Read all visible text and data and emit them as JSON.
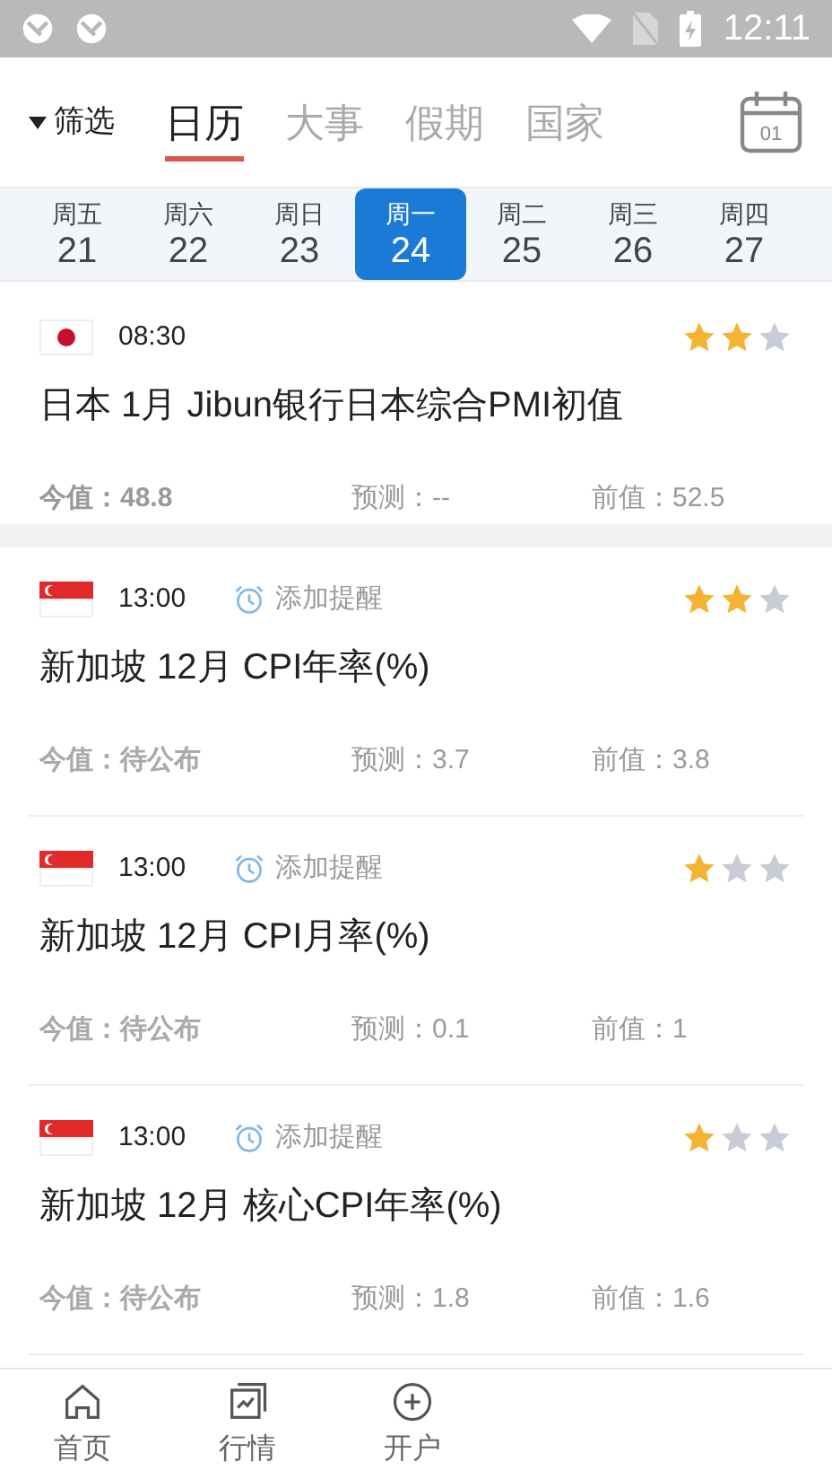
{
  "status_bar": {
    "time": "12:11"
  },
  "header": {
    "filter": "筛选",
    "tabs": [
      {
        "label": "日历",
        "selected": true
      },
      {
        "label": "大事",
        "selected": false
      },
      {
        "label": "假期",
        "selected": false
      },
      {
        "label": "国家",
        "selected": false
      }
    ],
    "calendar_day": "01"
  },
  "days": [
    {
      "weekday": "周五",
      "date": "21",
      "selected": false
    },
    {
      "weekday": "周六",
      "date": "22",
      "selected": false
    },
    {
      "weekday": "周日",
      "date": "23",
      "selected": false
    },
    {
      "weekday": "周一",
      "date": "24",
      "selected": true
    },
    {
      "weekday": "周二",
      "date": "25",
      "selected": false
    },
    {
      "weekday": "周三",
      "date": "26",
      "selected": false
    },
    {
      "weekday": "周四",
      "date": "27",
      "selected": false
    }
  ],
  "events": [
    {
      "kind": "japan",
      "time": "08:30",
      "stars": 2,
      "title": "日本 1月 Jibun银行日本综合PMI初值",
      "actual": "今值：48.8",
      "forecast": "预测：--",
      "previous": "前值：52.5"
    },
    {
      "kind": "singapore",
      "time": "13:00",
      "reminder": "添加提醒",
      "stars": 2,
      "title": "新加坡 12月 CPI年率(%)",
      "actual": "今值：待公布",
      "forecast": "预测：3.7",
      "previous": "前值：3.8"
    },
    {
      "kind": "singapore",
      "time": "13:00",
      "reminder": "添加提醒",
      "stars": 1,
      "title": "新加坡 12月 CPI月率(%)",
      "actual": "今值：待公布",
      "forecast": "预测：0.1",
      "previous": "前值：1"
    },
    {
      "kind": "singapore",
      "time": "13:00",
      "reminder": "添加提醒",
      "stars": 1,
      "title": "新加坡 12月 核心CPI年率(%)",
      "actual": "今值：待公布",
      "forecast": "预测：1.8",
      "previous": "前值：1.6"
    }
  ],
  "bottom_nav": [
    {
      "kind": "home",
      "label": "首页"
    },
    {
      "kind": "chart",
      "label": "行情"
    },
    {
      "kind": "plus",
      "label": "开户"
    }
  ]
}
